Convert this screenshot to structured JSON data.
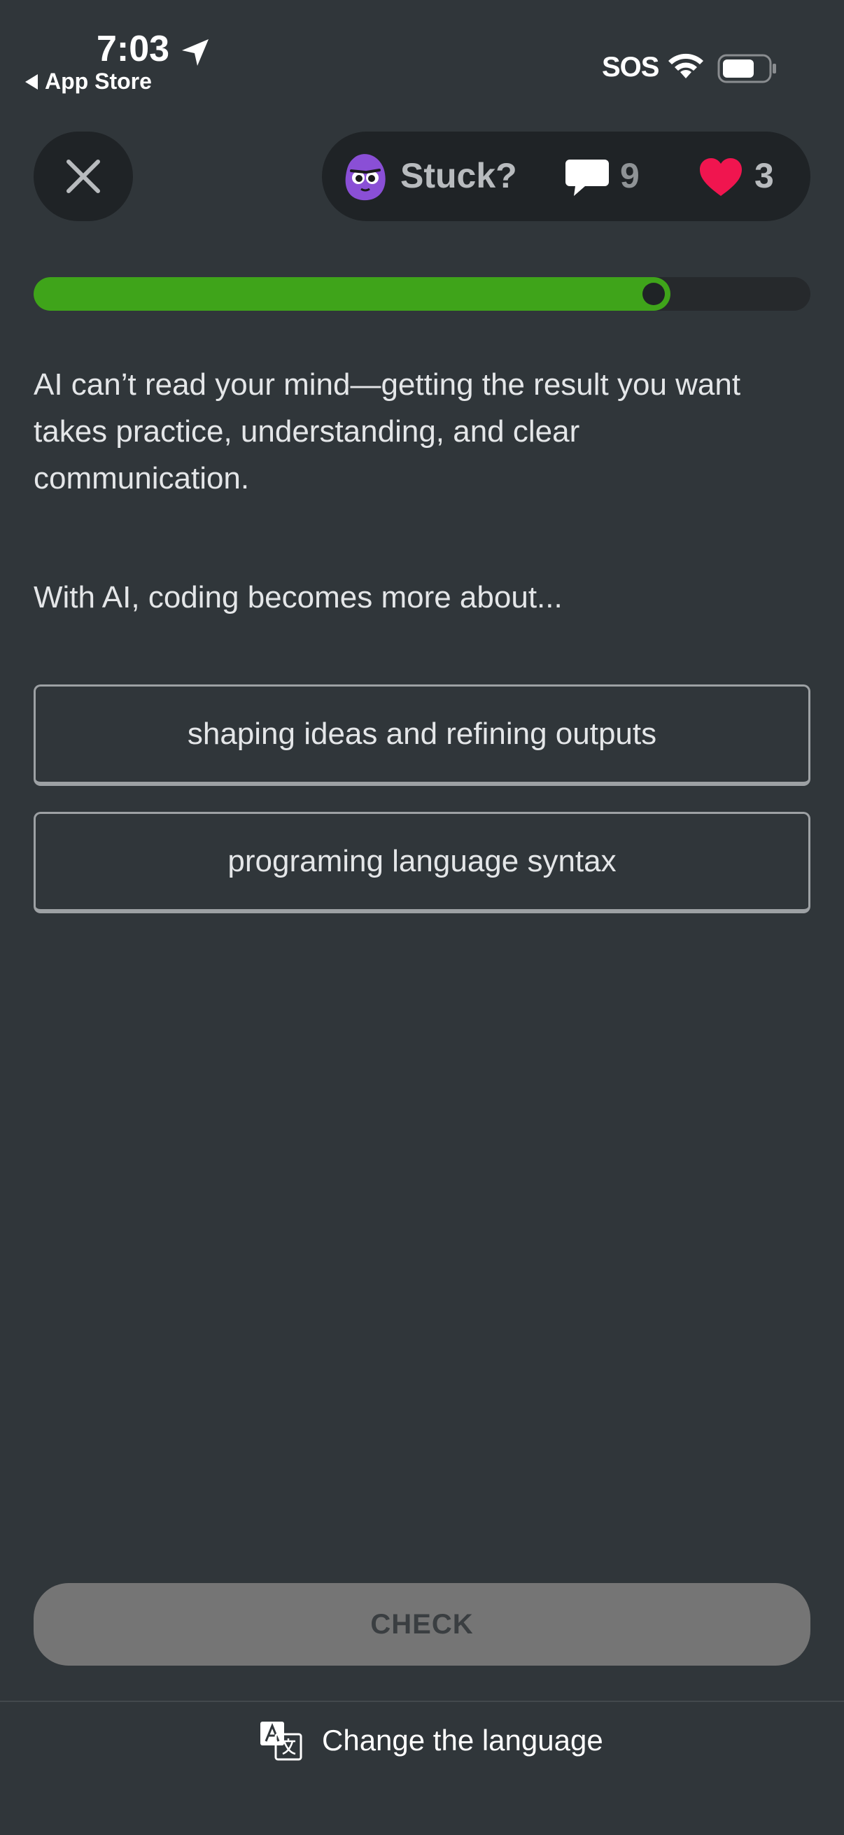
{
  "status_bar": {
    "time": "7:03",
    "back_label": "App Store",
    "sos": "SOS"
  },
  "header": {
    "stuck_label": "Stuck?",
    "comments_count": "9",
    "hearts_count": "3",
    "colors": {
      "heart": "#f0154f",
      "mascot": "#8a4fd6",
      "progress": "#3fa41a"
    }
  },
  "progress": {
    "fraction": 0.82
  },
  "lesson": {
    "intro": "AI can’t read your mind—getting the result you want takes practice, understanding, and clear communication.",
    "question": "With AI, coding becomes more about..."
  },
  "options": [
    {
      "label": "shaping ideas and refining outputs"
    },
    {
      "label": "programing language syntax"
    }
  ],
  "footer": {
    "check_label": "CHECK",
    "language_label": "Change the language"
  }
}
